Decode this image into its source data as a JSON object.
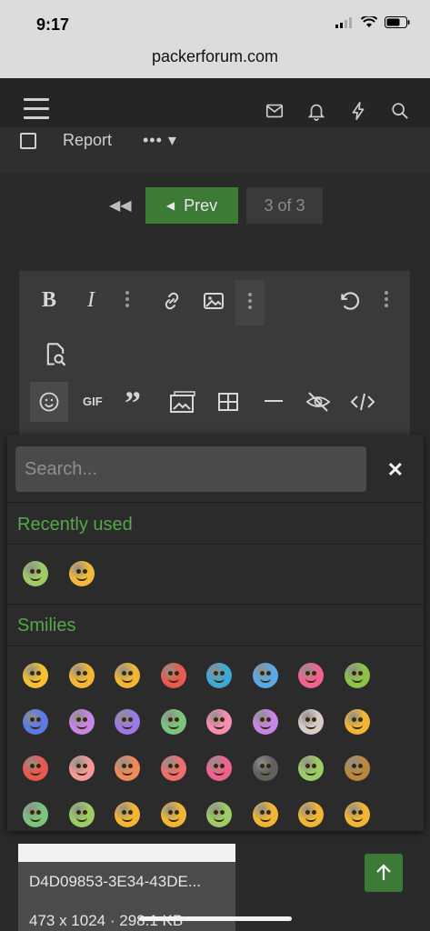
{
  "status_bar": {
    "time": "9:17"
  },
  "browser": {
    "url": "packerforum.com"
  },
  "post_actions": {
    "report_label": "Report",
    "more_label": "•••"
  },
  "pagination": {
    "prev_label": "Prev",
    "page_label": "3 of 3"
  },
  "editor_toolbar": {
    "row1": [
      "bold",
      "italic",
      "more-text",
      "link",
      "image",
      "more-insert",
      "undo",
      "more-options"
    ],
    "row2": [
      "preview"
    ],
    "row3": [
      "emoji",
      "gif",
      "quote",
      "media",
      "table",
      "horizontal-rule",
      "spoiler",
      "code"
    ],
    "gif_label": "GIF"
  },
  "emoji_panel": {
    "search_placeholder": "Search...",
    "close_label": "✕",
    "recent_title": "Recently used",
    "smilies_title": "Smilies",
    "recent": [
      {
        "color": "#9ccc65",
        "name": "zombie"
      },
      {
        "color": "#f0b93a",
        "name": "facepalm"
      }
    ],
    "smilies": [
      [
        "#f6c12f",
        "#f2b634",
        "#f2b634",
        "#e85a4f",
        "#3fa7d6",
        "#5aa9e6",
        "#f06292",
        "#8bc34a"
      ],
      [
        "#5c7ae6",
        "#c785e6",
        "#9b7ae6",
        "#7bc47f",
        "#f48fb1",
        "#c785e6",
        "#d7ccc8",
        "#f2b634"
      ],
      [
        "#e85a4f",
        "#f29999",
        "#f08a5d",
        "#ef6f6f",
        "#f06292",
        "#616161",
        "#9ccc65",
        "#b8893d"
      ],
      [
        "#7bc47f",
        "#9ccc65",
        "#f2b634",
        "#f2b634",
        "#9ccc65",
        "#f2b634",
        "#f2b634",
        "#f2b634"
      ]
    ]
  },
  "attachment": {
    "name": "D4D09853-3E34-43DE...",
    "meta": "473 x 1024 · 298.1 KB"
  },
  "colors": {
    "accent": "#3d7a35",
    "section_title": "#57a64c"
  }
}
